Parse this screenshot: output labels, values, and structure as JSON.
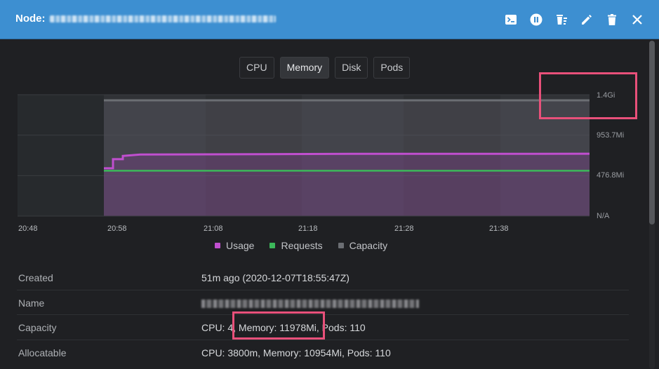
{
  "header": {
    "title": "Node:",
    "actions": [
      {
        "name": "terminal-icon",
        "label": ""
      },
      {
        "name": "pause-icon",
        "label": ""
      },
      {
        "name": "drain-icon",
        "label": ""
      },
      {
        "name": "edit-icon",
        "label": ""
      },
      {
        "name": "delete-icon",
        "label": ""
      },
      {
        "name": "close-icon",
        "label": ""
      }
    ]
  },
  "tabs": [
    {
      "label": "CPU",
      "active": false
    },
    {
      "label": "Memory",
      "active": true
    },
    {
      "label": "Disk",
      "active": false
    },
    {
      "label": "Pods",
      "active": false
    }
  ],
  "chart_data": {
    "type": "line",
    "x": [
      "20:48",
      "20:58",
      "21:08",
      "21:18",
      "21:28",
      "21:38"
    ],
    "yticks": [
      "N/A",
      "476.8Mi",
      "953.7Mi",
      "1.4Gi"
    ],
    "series": [
      {
        "name": "Usage",
        "color": "#c04fcf",
        "values": [
          null,
          660,
          760,
          765,
          766,
          768,
          770
        ]
      },
      {
        "name": "Requests",
        "color": "#3cb85a",
        "values": [
          null,
          560,
          560,
          560,
          560,
          560,
          560
        ]
      },
      {
        "name": "Capacity",
        "color": "#6b6e73",
        "values": [
          null,
          1430,
          1430,
          1430,
          1430,
          1430,
          1430
        ]
      }
    ],
    "legend_placement": "bottom-center",
    "grid": true
  },
  "legend": {
    "usage": "Usage",
    "requests": "Requests",
    "capacity": "Capacity"
  },
  "details": [
    {
      "label": "Created",
      "value": "51m ago (2020-12-07T18:55:47Z)"
    },
    {
      "label": "Name",
      "value": ""
    },
    {
      "label": "Capacity",
      "value": "CPU: 4, Memory: 11978Mi, Pods: 110"
    },
    {
      "label": "Allocatable",
      "value": "CPU: 3800m, Memory: 10954Mi, Pods: 110"
    }
  ],
  "colors": {
    "header": "#3d8fd1",
    "background": "#1f2023",
    "usage": "#c04fcf",
    "requests": "#3cb85a",
    "capacity": "#6b6e73",
    "highlight": "#e8507a"
  }
}
